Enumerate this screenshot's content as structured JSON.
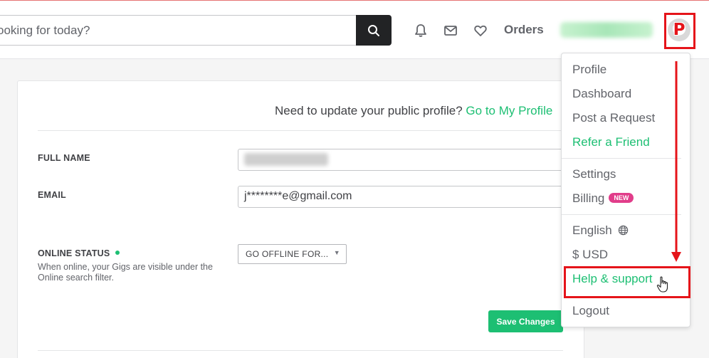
{
  "header": {
    "search_placeholder": "ooking for today?",
    "orders_label": "Orders",
    "avatar_letter": "P",
    "icons": [
      "search-icon",
      "bell-icon",
      "mail-icon",
      "heart-icon"
    ]
  },
  "profile_banner": {
    "text": "Need to update your public profile?",
    "link_text": "Go to My Profile"
  },
  "form": {
    "full_name_label": "FULL NAME",
    "email_label": "EMAIL",
    "email_value": "j********e@gmail.com",
    "online_status_label": "ONLINE STATUS",
    "online_status_description": "When online, your Gigs are visible under the Online search filter.",
    "online_status_select": "GO OFFLINE FOR...",
    "save_label": "Save Changes"
  },
  "menu": {
    "profile": "Profile",
    "dashboard": "Dashboard",
    "post_request": "Post a Request",
    "refer_friend": "Refer a Friend",
    "settings": "Settings",
    "billing": "Billing",
    "billing_badge": "NEW",
    "language": "English",
    "currency": "$ USD",
    "help_support": "Help & support",
    "logout": "Logout"
  },
  "colors": {
    "brand_green": "#1dbf73",
    "highlight_red": "#e5141a",
    "badge_pink": "#e13d8a"
  }
}
